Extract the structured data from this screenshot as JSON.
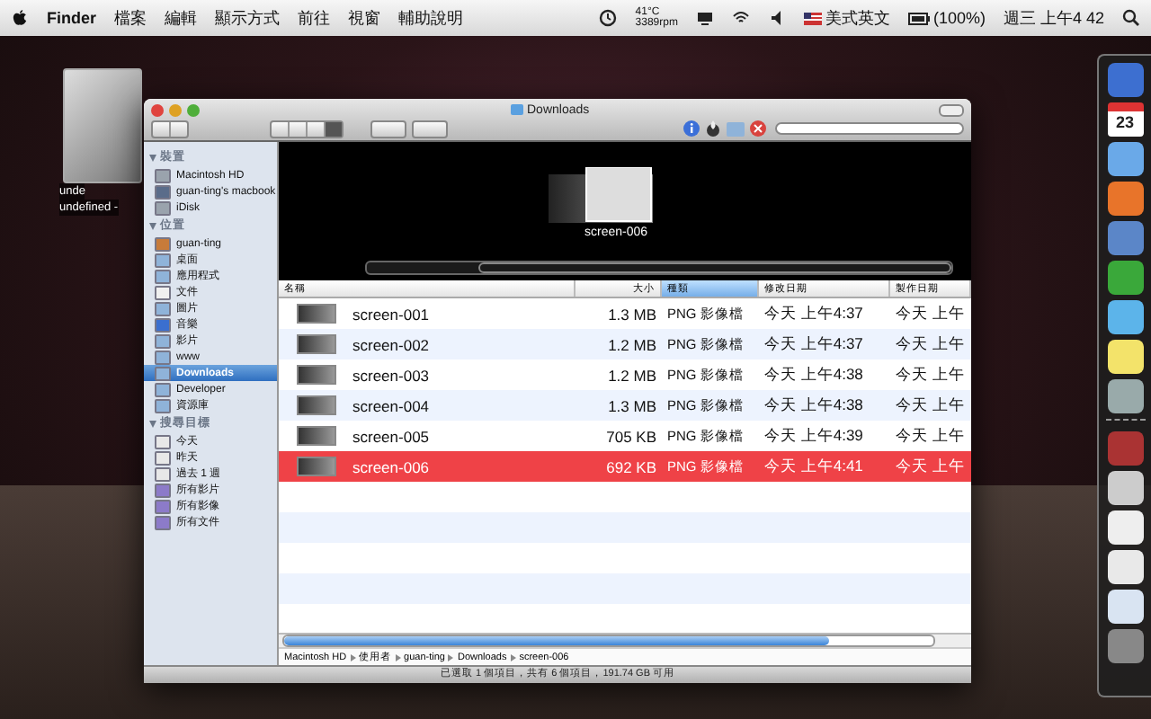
{
  "menubar": {
    "app": "Finder",
    "menus": [
      "檔案",
      "編輯",
      "顯示方式",
      "前往",
      "視窗",
      "輔助說明"
    ],
    "temperature": "41°C",
    "fan": "3389rpm",
    "input_source": "美式英文",
    "battery": "(100%)",
    "clock": "週三 上午4 42"
  },
  "desktop_icon": {
    "label_lines": [
      "unde",
      "undefined -"
    ]
  },
  "window": {
    "title": "Downloads",
    "sidebar": [
      {
        "heading": "裝置",
        "items": [
          {
            "label": "Macintosh HD",
            "selected": false
          },
          {
            "label": "guan-ting's macbook",
            "selected": false
          },
          {
            "label": "iDisk",
            "selected": false
          }
        ]
      },
      {
        "heading": "位置",
        "items": [
          {
            "label": "guan-ting",
            "selected": false
          },
          {
            "label": "桌面",
            "selected": false
          },
          {
            "label": "應用程式",
            "selected": false
          },
          {
            "label": "文件",
            "selected": false
          },
          {
            "label": "圖片",
            "selected": false
          },
          {
            "label": "音樂",
            "selected": false
          },
          {
            "label": "影片",
            "selected": false
          },
          {
            "label": "www",
            "selected": false
          },
          {
            "label": "Downloads",
            "selected": true
          },
          {
            "label": "Developer",
            "selected": false
          },
          {
            "label": "資源庫",
            "selected": false
          }
        ]
      },
      {
        "heading": "搜尋目標",
        "items": [
          {
            "label": "今天",
            "selected": false
          },
          {
            "label": "昨天",
            "selected": false
          },
          {
            "label": "過去 1 週",
            "selected": false
          },
          {
            "label": "所有影片",
            "selected": false
          },
          {
            "label": "所有影像",
            "selected": false
          },
          {
            "label": "所有文件",
            "selected": false
          }
        ]
      }
    ],
    "coverflow_caption": "screen-006",
    "columns": [
      {
        "label": "名稱",
        "sorted": false
      },
      {
        "label": "大小",
        "sorted": false
      },
      {
        "label": "種類",
        "sorted": true
      },
      {
        "label": "修改日期",
        "sorted": false
      },
      {
        "label": "製作日期",
        "sorted": false
      }
    ],
    "rows": [
      {
        "name": "screen-001",
        "size": "1.3 MB",
        "kind": "PNG 影像檔",
        "modified": "今天 上午4:37",
        "created": "今天 上午",
        "selected": false
      },
      {
        "name": "screen-002",
        "size": "1.2 MB",
        "kind": "PNG 影像檔",
        "modified": "今天 上午4:37",
        "created": "今天 上午",
        "selected": false
      },
      {
        "name": "screen-003",
        "size": "1.2 MB",
        "kind": "PNG 影像檔",
        "modified": "今天 上午4:38",
        "created": "今天 上午",
        "selected": false
      },
      {
        "name": "screen-004",
        "size": "1.3 MB",
        "kind": "PNG 影像檔",
        "modified": "今天 上午4:38",
        "created": "今天 上午",
        "selected": false
      },
      {
        "name": "screen-005",
        "size": "705 KB",
        "kind": "PNG 影像檔",
        "modified": "今天 上午4:39",
        "created": "今天 上午",
        "selected": false
      },
      {
        "name": "screen-006",
        "size": "692 KB",
        "kind": "PNG 影像檔",
        "modified": "今天 上午4:41",
        "created": "今天 上午",
        "selected": true
      }
    ],
    "path": [
      "Macintosh HD",
      "使用者",
      "guan-ting",
      "Downloads",
      "screen-006"
    ],
    "status": "已選取 1 個項目，共有 6 個項目，191.74 GB 可用"
  },
  "dock": {
    "calendar_day": "23"
  }
}
